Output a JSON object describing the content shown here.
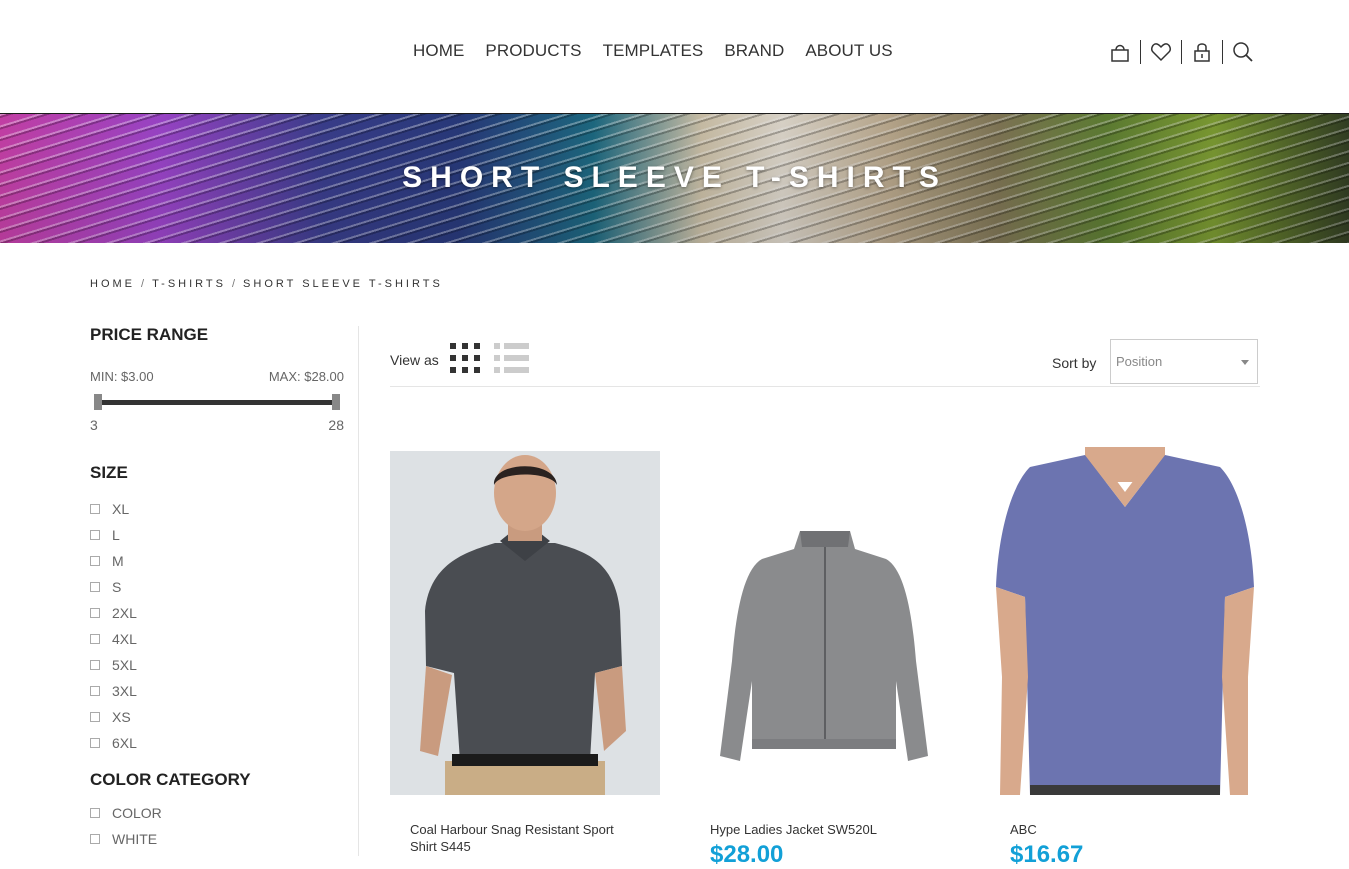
{
  "header": {
    "nav": [
      "HOME",
      "PRODUCTS",
      "TEMPLATES",
      "BRAND",
      "ABOUT US"
    ],
    "icons": [
      "cart-icon",
      "heart-icon",
      "lock-icon",
      "search-icon"
    ]
  },
  "banner": {
    "title": "SHORT SLEEVE T-SHIRTS"
  },
  "breadcrumb": [
    "HOME",
    "T-SHIRTS",
    "SHORT SLEEVE T-SHIRTS"
  ],
  "sidebar": {
    "price": {
      "title": "PRICE RANGE",
      "min_label": "MIN: $3.00",
      "max_label": "MAX: $28.00",
      "range_min": "3",
      "range_max": "28"
    },
    "size": {
      "title": "SIZE",
      "options": [
        "XL",
        "L",
        "M",
        "S",
        "2XL",
        "4XL",
        "5XL",
        "3XL",
        "XS",
        "6XL"
      ]
    },
    "color": {
      "title": "COLOR CATEGORY",
      "options": [
        "COLOR",
        "WHITE"
      ]
    }
  },
  "toolbar": {
    "view_as": "View as",
    "sort_by": "Sort by",
    "sort_value": "Position"
  },
  "products": [
    {
      "name": "Coal Harbour Snag Resistant Sport Shirt S445",
      "price": ""
    },
    {
      "name": "Hype Ladies Jacket SW520L",
      "price": "$28.00"
    },
    {
      "name": "ABC",
      "price": "$16.67"
    }
  ],
  "colors": {
    "accent": "#12a0d7"
  }
}
